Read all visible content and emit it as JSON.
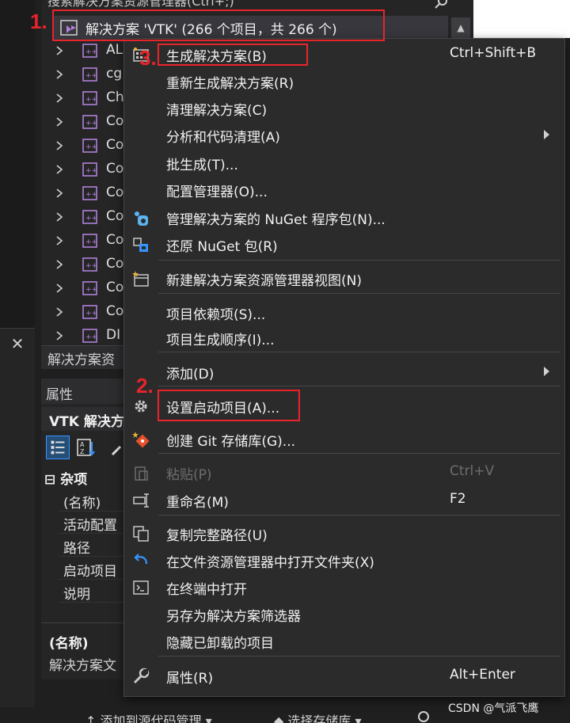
{
  "solution_explorer": {
    "search_placeholder": "搜索解决方案资源管理器(Ctrl+;)",
    "root_label": "解决方案 'VTK' (266 个项目，共 266 个)",
    "items": [
      "AL",
      "cg",
      "Ch",
      "Co",
      "Co",
      "Co",
      "Co",
      "Co",
      "Co",
      "Co",
      "Co",
      "Co",
      "DI"
    ],
    "footer_tab": "解决方案资"
  },
  "properties": {
    "title": "属性",
    "object_label": "VTK 解决方",
    "category": "杂项",
    "rows": [
      "(名称)",
      "活动配置",
      "路径",
      "启动项目",
      "说明"
    ],
    "description_title": "(名称)",
    "description_text": "解决方案文"
  },
  "context_menu": {
    "items": [
      {
        "label": "生成解决方案(B)",
        "shortcut": "Ctrl+Shift+B",
        "icon": "build-icon"
      },
      {
        "label": "重新生成解决方案(R)",
        "shortcut": ""
      },
      {
        "label": "清理解决方案(C)",
        "shortcut": ""
      },
      {
        "label": "分析和代码清理(A)",
        "shortcut": "",
        "submenu": true
      },
      {
        "label": "批生成(T)...",
        "shortcut": ""
      },
      {
        "label": "配置管理器(O)...",
        "shortcut": ""
      },
      {
        "label": "管理解决方案的 NuGet 程序包(N)...",
        "shortcut": "",
        "icon": "nuget-icon"
      },
      {
        "label": "还原 NuGet 包(R)",
        "shortcut": "",
        "icon": "restore-icon"
      },
      {
        "label": "新建解决方案资源管理器视图(N)",
        "shortcut": "",
        "icon": "new-view-icon"
      },
      {
        "label": "项目依赖项(S)...",
        "shortcut": ""
      },
      {
        "label": "项目生成顺序(I)...",
        "shortcut": ""
      },
      {
        "label": "添加(D)",
        "shortcut": "",
        "submenu": true
      },
      {
        "label": "设置启动项目(A)...",
        "shortcut": "",
        "icon": "gear-icon"
      },
      {
        "label": "创建 Git 存储库(G)...",
        "shortcut": "",
        "icon": "git-icon"
      },
      {
        "label": "粘贴(P)",
        "shortcut": "Ctrl+V",
        "icon": "paste-icon",
        "disabled": true
      },
      {
        "label": "重命名(M)",
        "shortcut": "F2",
        "icon": "rename-icon"
      },
      {
        "label": "复制完整路径(U)",
        "shortcut": "",
        "icon": "copy-icon"
      },
      {
        "label": "在文件资源管理器中打开文件夹(X)",
        "shortcut": "",
        "icon": "open-folder-icon"
      },
      {
        "label": "在终端中打开",
        "shortcut": "",
        "icon": "terminal-icon"
      },
      {
        "label": "另存为解决方案筛选器",
        "shortcut": ""
      },
      {
        "label": "隐藏已卸载的项目",
        "shortcut": ""
      },
      {
        "label": "属性(R)",
        "shortcut": "Alt+Enter",
        "icon": "wrench-icon"
      }
    ]
  },
  "annotations": [
    "1.",
    "2.",
    "3."
  ],
  "bottom_bar": {
    "left_text": "↑ 添加到源代码管理 ▾",
    "mid_text": "◆ 选择存储库 ▾"
  },
  "watermark": "CSDN @气派飞鹰",
  "colors": {
    "background": "#1f1f1f",
    "menu_bg": "#2b2b2b",
    "panel_bg": "#252526",
    "text": "#f1f1f1",
    "disabled_text": "#6d6d6d",
    "annotation_red": "#e8242b",
    "vs_purple": "#b180d7"
  }
}
